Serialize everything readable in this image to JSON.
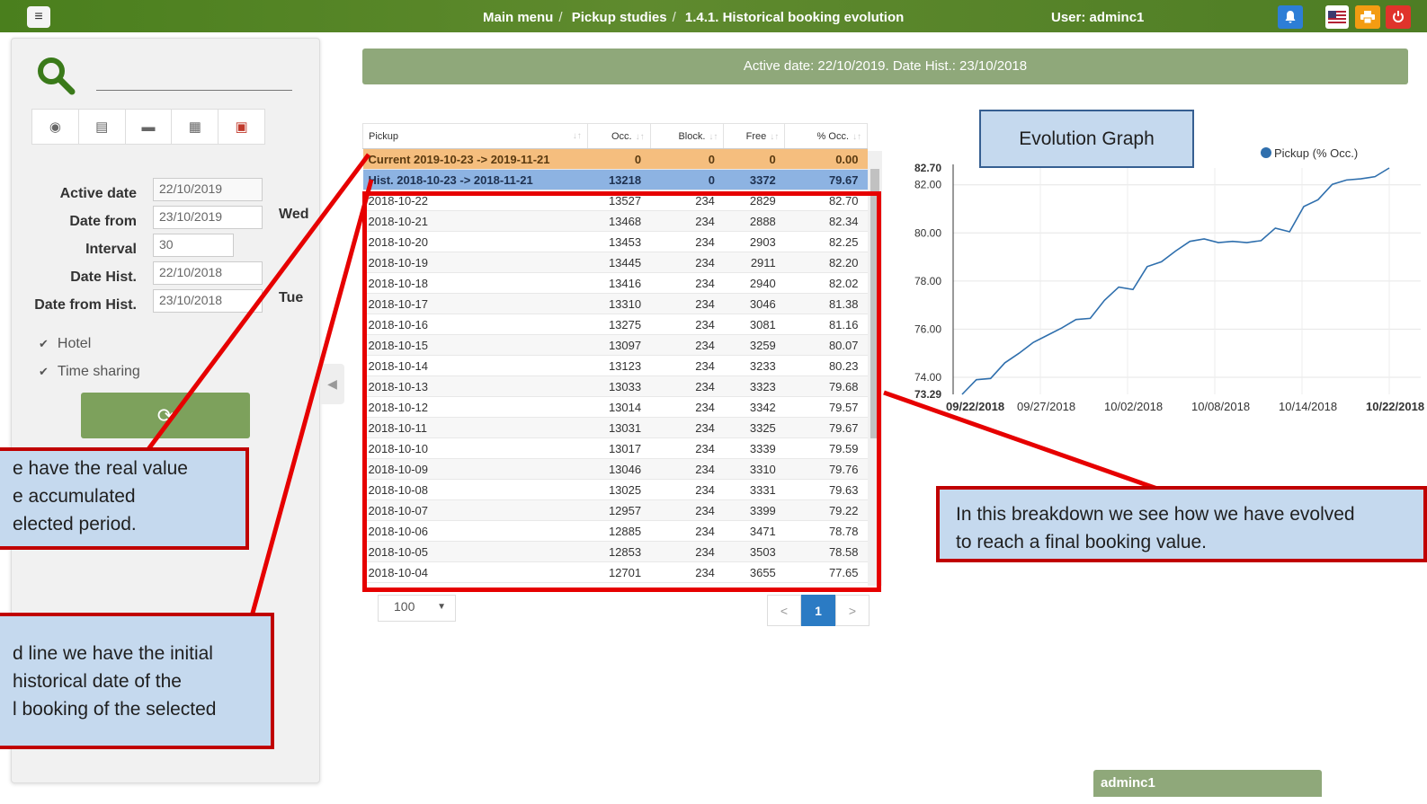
{
  "topbar": {
    "breadcrumb": [
      "Main menu",
      "Pickup studies",
      "1.4.1. Historical booking evolution"
    ],
    "user": "User: adminc1"
  },
  "filters": {
    "active_date_label": "Active date",
    "active_date": "22/10/2019",
    "date_from_label": "Date from",
    "date_from": "23/10/2019",
    "date_from_weekday": "Wed",
    "interval_label": "Interval",
    "interval": "30",
    "date_hist_label": "Date Hist.",
    "date_hist": "22/10/2018",
    "date_from_hist_label": "Date from Hist.",
    "date_from_hist": "23/10/2018",
    "date_from_hist_weekday": "Tue",
    "hotel_label": "Hotel",
    "time_sharing_label": "Time sharing"
  },
  "infobar": "Active date: 22/10/2019. Date Hist.: 23/10/2018",
  "table": {
    "headers": [
      "Pickup",
      "Occ.",
      "Block.",
      "Free",
      "% Occ."
    ],
    "current": [
      "Current 2019-10-23 -> 2019-11-21",
      "0",
      "0",
      "0",
      "0.00"
    ],
    "hist": [
      "Hist. 2018-10-23 -> 2018-11-21",
      "13218",
      "0",
      "3372",
      "79.67"
    ],
    "rows": [
      [
        "2018-10-22",
        "13527",
        "234",
        "2829",
        "82.70"
      ],
      [
        "2018-10-21",
        "13468",
        "234",
        "2888",
        "82.34"
      ],
      [
        "2018-10-20",
        "13453",
        "234",
        "2903",
        "82.25"
      ],
      [
        "2018-10-19",
        "13445",
        "234",
        "2911",
        "82.20"
      ],
      [
        "2018-10-18",
        "13416",
        "234",
        "2940",
        "82.02"
      ],
      [
        "2018-10-17",
        "13310",
        "234",
        "3046",
        "81.38"
      ],
      [
        "2018-10-16",
        "13275",
        "234",
        "3081",
        "81.16"
      ],
      [
        "2018-10-15",
        "13097",
        "234",
        "3259",
        "80.07"
      ],
      [
        "2018-10-14",
        "13123",
        "234",
        "3233",
        "80.23"
      ],
      [
        "2018-10-13",
        "13033",
        "234",
        "3323",
        "79.68"
      ],
      [
        "2018-10-12",
        "13014",
        "234",
        "3342",
        "79.57"
      ],
      [
        "2018-10-11",
        "13031",
        "234",
        "3325",
        "79.67"
      ],
      [
        "2018-10-10",
        "13017",
        "234",
        "3339",
        "79.59"
      ],
      [
        "2018-10-09",
        "13046",
        "234",
        "3310",
        "79.76"
      ],
      [
        "2018-10-08",
        "13025",
        "234",
        "3331",
        "79.63"
      ],
      [
        "2018-10-07",
        "12957",
        "234",
        "3399",
        "79.22"
      ],
      [
        "2018-10-06",
        "12885",
        "234",
        "3471",
        "78.78"
      ],
      [
        "2018-10-05",
        "12853",
        "234",
        "3503",
        "78.58"
      ],
      [
        "2018-10-04",
        "12701",
        "234",
        "3655",
        "77.65"
      ]
    ],
    "page_size": "100",
    "pager": {
      "prev": "<",
      "current": "1",
      "next": ">"
    }
  },
  "annotations": {
    "graph_title": "Evolution Graph",
    "left_top": [
      "e have the real value",
      "e accumulated",
      "elected period."
    ],
    "left_bottom": [
      "d line we have the initial",
      "historical date of the",
      "l booking of the selected"
    ],
    "right": [
      "In this breakdown we see how we have evolved",
      "to reach a final booking value."
    ]
  },
  "chart_data": {
    "type": "line",
    "legend": "Pickup (% Occ.)",
    "series_color": "#2f6fad",
    "y_ticks": [
      "82.70",
      "82.00",
      "80.00",
      "78.00",
      "76.00",
      "74.00",
      "73.29"
    ],
    "x_ticks": [
      "09/22/2018",
      "09/27/2018",
      "10/02/2018",
      "10/08/2018",
      "10/14/2018",
      "10/22/2018"
    ],
    "ylim": [
      73.29,
      82.7
    ],
    "y": [
      73.29,
      73.9,
      73.95,
      74.6,
      75.0,
      75.45,
      75.75,
      76.05,
      76.4,
      76.45,
      77.2,
      77.75,
      77.65,
      78.6,
      78.8,
      79.25,
      79.65,
      79.75,
      79.6,
      79.65,
      79.6,
      79.68,
      80.2,
      80.05,
      81.1,
      81.38,
      82.02,
      82.2,
      82.25,
      82.34,
      82.7
    ]
  },
  "footer_user": "adminc1"
}
